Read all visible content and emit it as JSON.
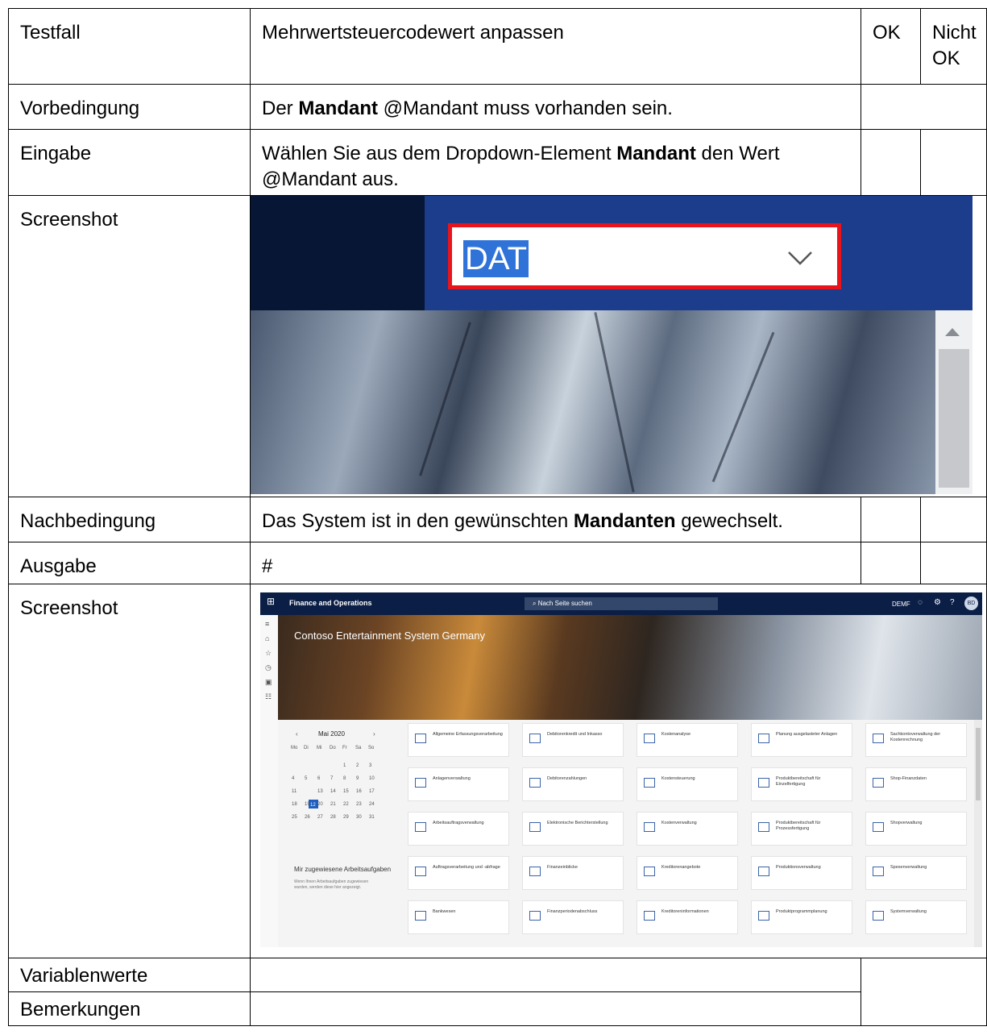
{
  "rows": {
    "testfall": {
      "label": "Testfall",
      "value": "Mehrwertsteuercodewert anpassen",
      "ok": "OK",
      "nicht_ok": "Nicht OK"
    },
    "vorbedingung": {
      "label": "Vorbedingung",
      "pre": "Der ",
      "bold": "Mandant",
      "post": " @Mandant muss vorhanden sein."
    },
    "eingabe": {
      "label": "Eingabe",
      "pre": "Wählen Sie aus dem Dropdown-Element ",
      "bold": "Mandant",
      "post": " den Wert @Mandant aus."
    },
    "screenshot1": {
      "label": "Screenshot"
    },
    "nachbedingung": {
      "label": "Nachbedingung",
      "pre": "Das System ist in den gewünschten ",
      "bold": "Mandanten",
      "post": " gewechselt."
    },
    "ausgabe": {
      "label": "Ausgabe",
      "value": "#"
    },
    "screenshot2": {
      "label": "Screenshot"
    },
    "variablenwerte": {
      "label": "Variablenwerte",
      "value": ""
    },
    "bemerkungen": {
      "label": "Bemerkungen",
      "value": ""
    }
  },
  "shot1": {
    "dropdown_value": "DAT",
    "icon": "chevron-down-icon"
  },
  "shot2": {
    "app_name": "Finance and Operations",
    "search_placeholder": "Nach Seite suchen",
    "entity": "DEMF",
    "avatar": "BD",
    "banner_title": "Contoso Entertainment System Germany",
    "calendar": {
      "month": "Mai",
      "year": "2020",
      "weekdays": [
        "Mo",
        "Di",
        "Mi",
        "Do",
        "Fr",
        "Sa",
        "So"
      ],
      "weeks": [
        [
          "",
          "",
          "",
          "",
          "1",
          "2",
          "3"
        ],
        [
          "4",
          "5",
          "6",
          "7",
          "8",
          "9",
          "10"
        ],
        [
          "11",
          "12",
          "13",
          "14",
          "15",
          "16",
          "17"
        ],
        [
          "18",
          "19",
          "20",
          "21",
          "22",
          "23",
          "24"
        ],
        [
          "25",
          "26",
          "27",
          "28",
          "29",
          "30",
          "31"
        ]
      ],
      "selected": "12"
    },
    "assigned_title": "Mir zugewiesene Arbeitsaufgaben",
    "assigned_note": "Wenn Ihnen Arbeitsaufgaben zugewiesen wurden, werden diese hier angezeigt.",
    "tiles": [
      [
        "Allgemeine Erfassungsverarbeitung",
        "Debitorenkredit und Inkasso",
        "Kostenanalyse",
        "Planung ausgelasteter Anlagen",
        "Sachkontoverwaltung der Kostenrechnung"
      ],
      [
        "Anlagenverwaltung",
        "Debitorenzahlungen",
        "Kostensteuerung",
        "Produktbereitschaft für Einzelfertigung",
        "Shop-Finanzdaten"
      ],
      [
        "Arbeitsauftragsverwaltung",
        "Elektronische Berichterstellung",
        "Kostenverwaltung",
        "Produktbereitschaft für Prozessfertigung",
        "Shopverwaltung"
      ],
      [
        "Auftragsverarbeitung und -abfrage",
        "Finanzeinblicke",
        "Kreditorenangebote",
        "Produktionsverwaltung",
        "Spesenverwaltung"
      ],
      [
        "Bankwesen",
        "Finanzperiodenabschluss",
        "Kreditoreninformationen",
        "Produktprogrammplanung",
        "Systemverwaltung"
      ]
    ]
  }
}
